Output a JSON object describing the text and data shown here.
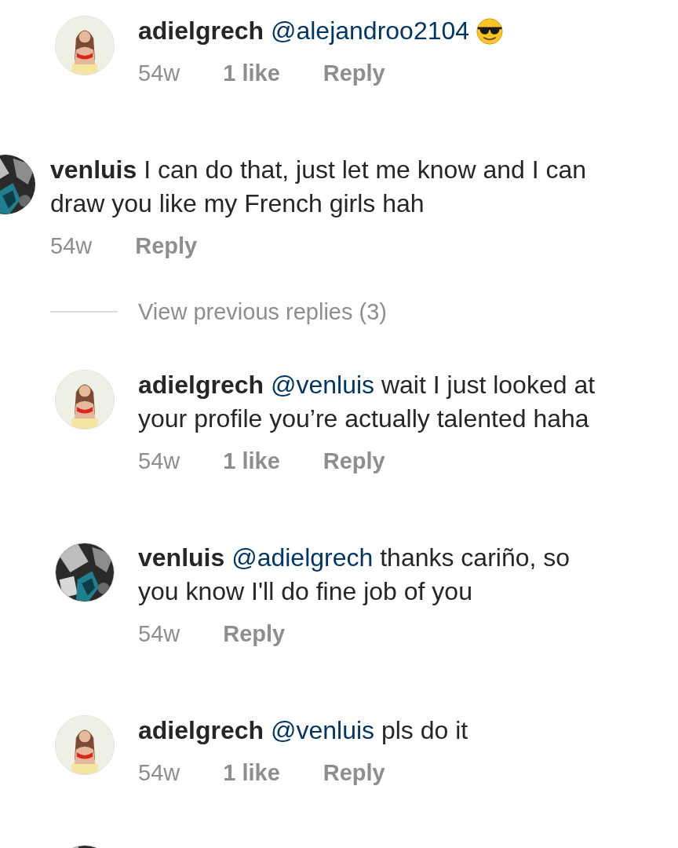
{
  "rows": [
    {
      "kind": "reply",
      "avatar": {
        "kind": "picture",
        "dark": false
      },
      "user": "adielgrech",
      "mention": "@alejandroo2104",
      "text": "",
      "has_emoji": true,
      "time": "54w",
      "likes": "1 like",
      "reply": "Reply"
    },
    {
      "kind": "comment",
      "avatar": {
        "kind": "picture",
        "dark": true
      },
      "user": "venluis",
      "mention": "",
      "text": "I can do that, just let me know and I can draw you like my French girls hah",
      "time": "54w",
      "reply": "Reply"
    },
    {
      "kind": "view_replies",
      "label": "View previous replies (3)"
    },
    {
      "kind": "reply",
      "avatar": {
        "kind": "picture",
        "dark": false
      },
      "user": "adielgrech",
      "mention": "@venluis",
      "text": "wait I just looked at your profile you’re actually talented haha",
      "time": "54w",
      "likes": "1 like",
      "reply": "Reply"
    },
    {
      "kind": "reply",
      "avatar": {
        "kind": "picture",
        "dark": true
      },
      "user": "venluis",
      "mention": "@adielgrech",
      "text": "thanks cariño, so you know I'll do fine job of you",
      "time": "54w",
      "reply": "Reply"
    },
    {
      "kind": "reply",
      "avatar": {
        "kind": "picture",
        "dark": false
      },
      "user": "adielgrech",
      "mention": "@venluis",
      "text": "pls do it",
      "time": "54w",
      "likes": "1 like",
      "reply": "Reply"
    },
    {
      "kind": "cut",
      "avatar": {
        "kind": "picture",
        "dark": true
      }
    }
  ]
}
